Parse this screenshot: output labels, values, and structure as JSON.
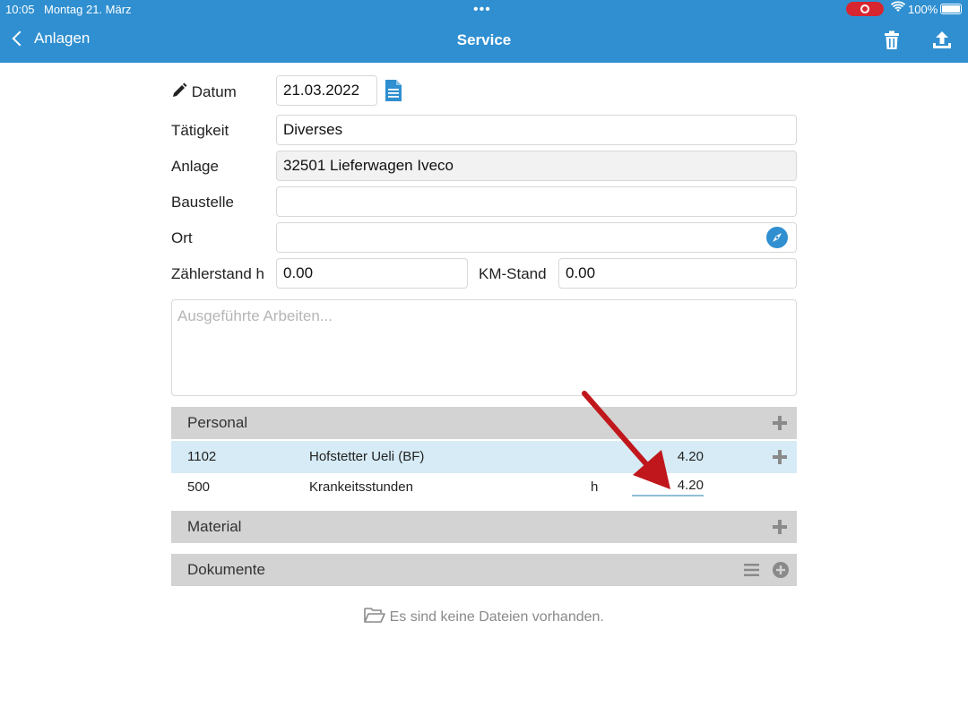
{
  "status": {
    "time": "10:05",
    "date": "Montag 21. März",
    "battery": "100%"
  },
  "nav": {
    "back_label": "Anlagen",
    "title": "Service"
  },
  "form": {
    "datum_label": "Datum",
    "datum_value": "21.03.2022",
    "taetigkeit_label": "Tätigkeit",
    "taetigkeit_value": "Diverses",
    "anlage_label": "Anlage",
    "anlage_value": "32501 Lieferwagen Iveco",
    "baustelle_label": "Baustelle",
    "baustelle_value": "",
    "ort_label": "Ort",
    "ort_value": "",
    "zaehler_label": "Zählerstand h",
    "zaehler_value": "0.00",
    "km_label": "KM-Stand",
    "km_value": "0.00",
    "arbeiten_placeholder": "Ausgeführte Arbeiten..."
  },
  "personal": {
    "header": "Personal",
    "rows": [
      {
        "code": "1102",
        "name": "Hofstetter Ueli (BF)",
        "unit": "",
        "value": "4.20"
      },
      {
        "code": "500",
        "name": "Krankeitsstunden",
        "unit": "h",
        "value": "4.20"
      }
    ]
  },
  "material": {
    "header": "Material"
  },
  "dokumente": {
    "header": "Dokumente",
    "empty_text": "Es sind keine Dateien vorhanden."
  },
  "colors": {
    "accent": "#2f8fd0",
    "section_bg": "#d3d3d3",
    "selected_row": "#d6ebf5",
    "annotation_arrow": "#c0171c"
  }
}
